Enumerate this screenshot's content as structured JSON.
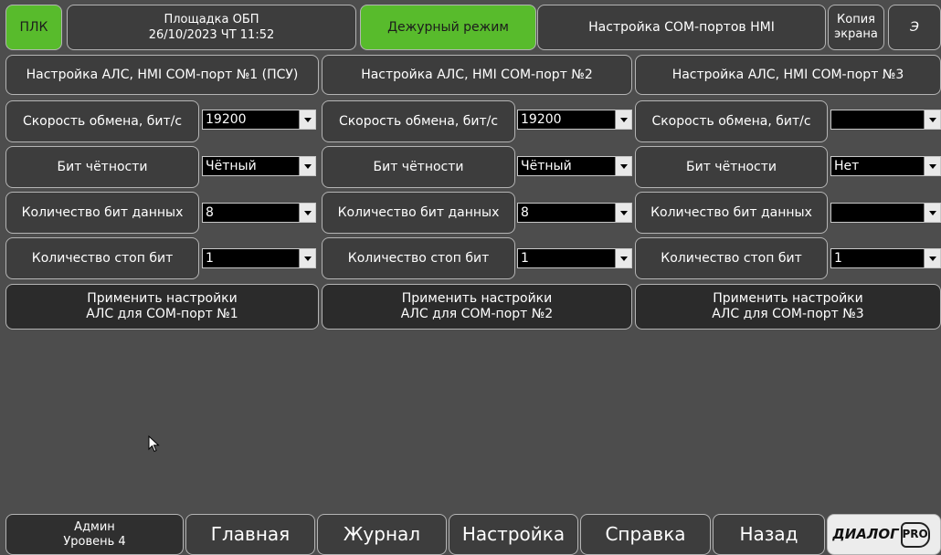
{
  "header": {
    "plc_label": "ПЛК",
    "site_name": "Площадка ОБП",
    "datetime": "26/10/2023 ЧТ 11:52",
    "mode": "Дежурный режим",
    "screen_title": "Настройка COM-портов HMI",
    "copy_screen_line1": "Копия",
    "copy_screen_line2": "экрана",
    "extra_button": "Э"
  },
  "columns": [
    {
      "title": "Настройка АЛС, HMI COM-порт №1 (ПСУ)",
      "baud_label": "Скорость обмена, бит/с",
      "baud_value": "19200",
      "parity_label": "Бит чётности",
      "parity_value": "Чётный",
      "databits_label": "Количество бит данных",
      "databits_value": "8",
      "stopbits_label": "Количество стоп бит",
      "stopbits_value": "1",
      "apply_line1": "Применить настройки",
      "apply_line2": "АЛС для COM-порт №1"
    },
    {
      "title": "Настройка АЛС, HMI COM-порт №2",
      "baud_label": "Скорость обмена, бит/с",
      "baud_value": "19200",
      "parity_label": "Бит чётности",
      "parity_value": "Чётный",
      "databits_label": "Количество бит данных",
      "databits_value": "8",
      "stopbits_label": "Количество стоп бит",
      "stopbits_value": "1",
      "apply_line1": "Применить настройки",
      "apply_line2": "АЛС для COM-порт №2"
    },
    {
      "title": "Настройка АЛС, HMI COM-порт №3",
      "baud_label": "Скорость обмена, бит/с",
      "baud_value": "",
      "parity_label": "Бит чётности",
      "parity_value": "Нет",
      "databits_label": "Количество бит данных",
      "databits_value": "",
      "stopbits_label": "Количество стоп бит",
      "stopbits_value": "1",
      "apply_line1": "Применить настройки",
      "apply_line2": "АЛС для COM-порт №3"
    }
  ],
  "footer": {
    "user_name": "Админ",
    "user_level": "Уровень 4",
    "nav": [
      "Главная",
      "Журнал",
      "Настройка",
      "Справка",
      "Назад"
    ],
    "logo_main": "ДИАЛОГ",
    "logo_pro": "PRO"
  },
  "icons": {
    "cursor": "mouse-pointer-icon",
    "dropdown": "chevron-down-icon"
  },
  "colors": {
    "background": "#4d4d4d",
    "button": "#3d3d3d",
    "mode_active": "#58bb2c",
    "field": "#000000"
  }
}
